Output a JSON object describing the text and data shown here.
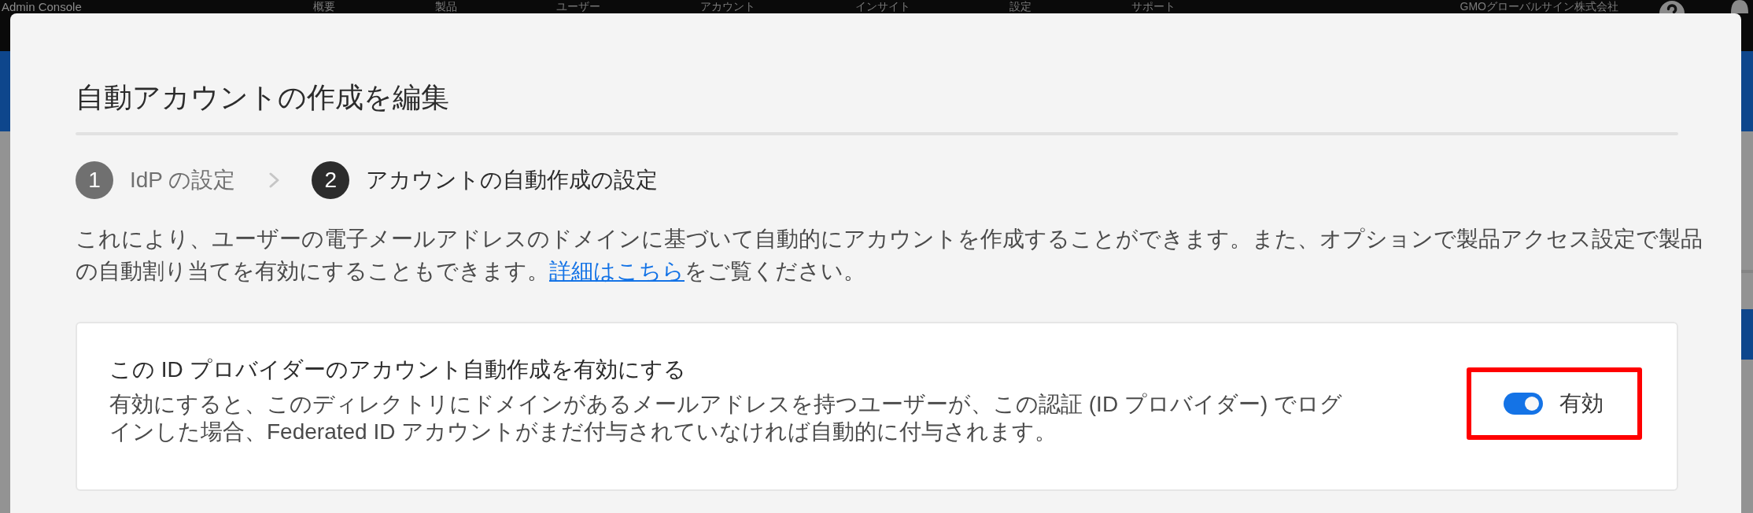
{
  "top_bar": {
    "title": "Admin Console",
    "nav": [
      "概要",
      "製品",
      "ユーザー",
      "アカウント",
      "インサイト",
      "設定",
      "サポート"
    ],
    "organization": "GMOグローバルサイン株式会社"
  },
  "dialog": {
    "title": "自動アカウントの作成を編集",
    "steps": [
      {
        "number": "1",
        "label": "IdP の設定",
        "selected": false
      },
      {
        "number": "2",
        "label": "アカウントの自動作成の設定",
        "selected": true
      }
    ],
    "description": {
      "text": "これにより、ユーザーの電子メールアドレスのドメインに基づいて自動的にアカウントを作成することができます。また、オプションで製品アクセス設定で製品の自動割り当てを有効にすることもできます。",
      "link": "詳細はこちら",
      "text_after": "をご覧ください。"
    },
    "setting": {
      "title": "この ID プロバイダーのアカウント自動作成を有効にする",
      "description": "有効にすると、このディレクトリにドメインがあるメールアドレスを持つユーザーが、この認証 (ID プロバイダー) でログインした場合、Federated ID アカウントがまだ付与されていなければ自動的に付与されます。",
      "toggle": {
        "on": true,
        "label": "有効",
        "highlighted": true
      }
    }
  }
}
